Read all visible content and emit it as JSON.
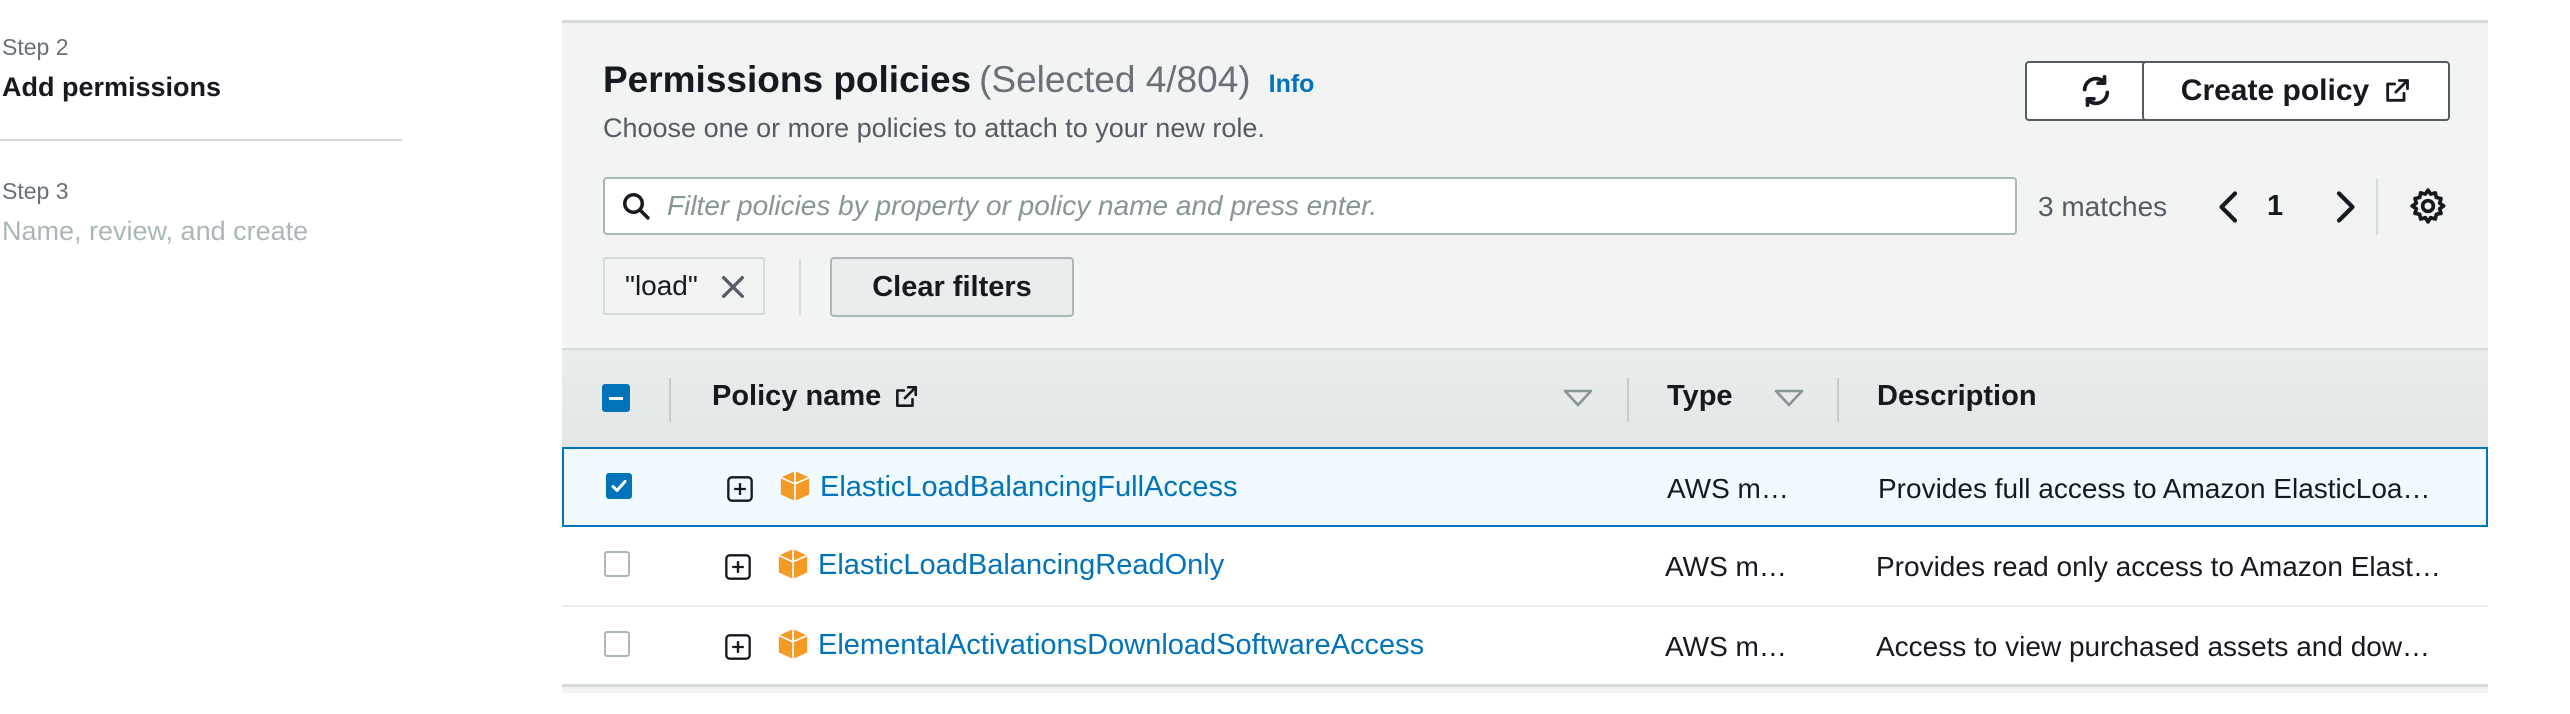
{
  "steps": [
    {
      "number": "Step 2",
      "title": "Add permissions"
    },
    {
      "number": "Step 3",
      "title": "Name, review, and create"
    }
  ],
  "panel": {
    "title": "Permissions policies",
    "selected_count": "(Selected 4/804)",
    "info_label": "Info",
    "description": "Choose one or more policies to attach to your new role.",
    "create_policy_label": "Create policy"
  },
  "search": {
    "placeholder": "Filter policies by property or policy name and press enter.",
    "value": ""
  },
  "pagination": {
    "matches": "3 matches",
    "current_page": "1"
  },
  "filter": {
    "token": "\"load\"",
    "clear_label": "Clear filters"
  },
  "table": {
    "columns": [
      "Policy name",
      "Type",
      "Description"
    ],
    "rows": [
      {
        "name": "ElasticLoadBalancingFullAccess",
        "type": "AWS m…",
        "description": "Provides full access to Amazon ElasticLoa…",
        "checked": true
      },
      {
        "name": "ElasticLoadBalancingReadOnly",
        "type": "AWS m…",
        "description": "Provides read only access to Amazon Elast…",
        "checked": false
      },
      {
        "name": "ElementalActivationsDownloadSoftwareAccess",
        "type": "AWS m…",
        "description": "Access to view purchased assets and dow…",
        "checked": false
      }
    ]
  },
  "colors": {
    "link": "#0073bb",
    "selected_row_bg": "#f1faff",
    "package_icon": "#f49b26"
  }
}
